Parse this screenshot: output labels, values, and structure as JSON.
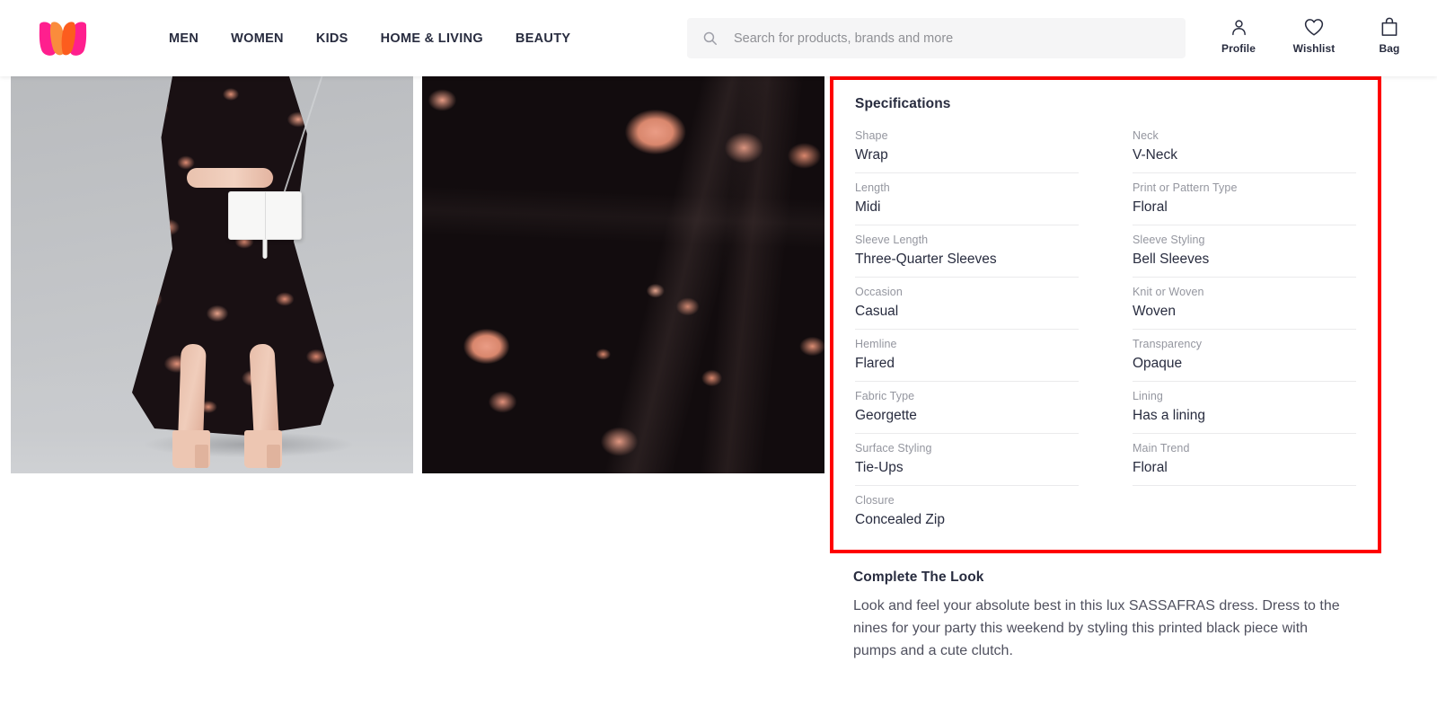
{
  "header": {
    "logo": {
      "name": "myntra-logo",
      "colors": {
        "pink": "#ff3f6c",
        "orange": "#f16565",
        "orange_deep": "#fa6c25"
      }
    },
    "nav": [
      {
        "label": "MEN"
      },
      {
        "label": "WOMEN"
      },
      {
        "label": "KIDS"
      },
      {
        "label": "HOME & LIVING"
      },
      {
        "label": "BEAUTY"
      }
    ],
    "search": {
      "icon": "search-icon",
      "placeholder": "Search for products, brands and more",
      "value": ""
    },
    "actions": [
      {
        "icon": "profile-icon",
        "label": "Profile"
      },
      {
        "icon": "wishlist-heart-icon",
        "label": "Wishlist"
      },
      {
        "icon": "bag-icon",
        "label": "Bag"
      }
    ]
  },
  "gallery": {
    "images": [
      {
        "name": "product-image-model",
        "alt": "Model wearing black floral midi wrap dress with white clutch"
      },
      {
        "name": "product-image-fabric-closeup",
        "alt": "Close-up of black georgette fabric with peach floral print"
      }
    ]
  },
  "specifications": {
    "title": "Specifications",
    "highlight_color": "#ff0000",
    "left_column": [
      {
        "key": "Shape",
        "value": "Wrap"
      },
      {
        "key": "Length",
        "value": "Midi"
      },
      {
        "key": "Sleeve Length",
        "value": "Three-Quarter Sleeves"
      },
      {
        "key": "Occasion",
        "value": "Casual"
      },
      {
        "key": "Hemline",
        "value": "Flared"
      },
      {
        "key": "Fabric Type",
        "value": "Georgette"
      },
      {
        "key": "Surface Styling",
        "value": "Tie-Ups"
      },
      {
        "key": "Closure",
        "value": "Concealed Zip"
      }
    ],
    "right_column": [
      {
        "key": "Neck",
        "value": "V-Neck"
      },
      {
        "key": "Print or Pattern Type",
        "value": "Floral"
      },
      {
        "key": "Sleeve Styling",
        "value": "Bell Sleeves"
      },
      {
        "key": "Knit or Woven",
        "value": "Woven"
      },
      {
        "key": "Transparency",
        "value": "Opaque"
      },
      {
        "key": "Lining",
        "value": "Has a lining"
      },
      {
        "key": "Main Trend",
        "value": "Floral"
      }
    ]
  },
  "complete_the_look": {
    "title": "Complete The Look",
    "description": "Look and feel your absolute best in this lux SASSAFRAS dress. Dress to the nines for your party this weekend by styling this printed black piece with pumps and a cute clutch."
  }
}
